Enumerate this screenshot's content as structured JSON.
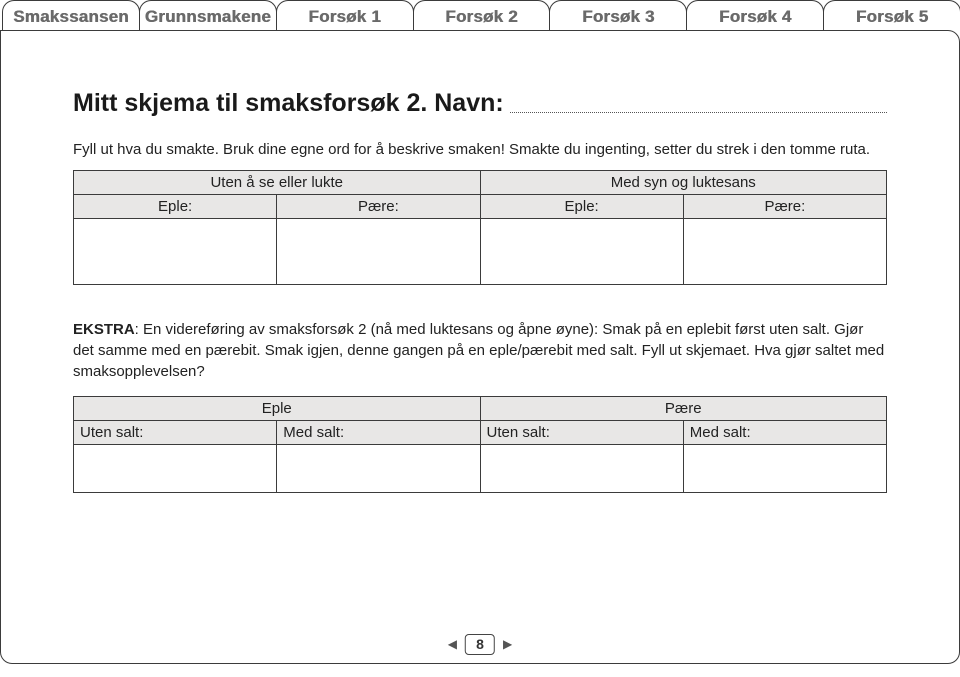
{
  "tabs": {
    "t0": "Smakssansen",
    "t1": "Grunnsmakene",
    "t2": "Forsøk 1",
    "t3": "Forsøk 2",
    "t4": "Forsøk 3",
    "t5": "Forsøk 4",
    "t6": "Forsøk 5"
  },
  "title": "Mitt skjema til smaksforsøk 2. Navn:",
  "instructions": "Fyll ut hva du smakte. Bruk dine egne ord for å beskrive smaken! Smakte du ingenting, setter du strek i den tomme ruta.",
  "table1": {
    "hdr1": "Uten å se eller lukte",
    "hdr2": "Med syn og luktesans",
    "c1": "Eple:",
    "c2": "Pære:",
    "c3": "Eple:",
    "c4": "Pære:"
  },
  "extra_bold": "EKSTRA",
  "extra_text": ": En videreføring av smaksforsøk 2 (nå med luktesans og åpne øyne): Smak på en eplebit først uten salt. Gjør det samme med en pærebit. Smak igjen, denne gangen på en eple/pærebit med salt. Fyll ut skjemaet. Hva gjør saltet med smaksopplevelsen?",
  "table2": {
    "hdr1": "Eple",
    "hdr2": "Pære",
    "c1": "Uten salt:",
    "c2": "Med salt:",
    "c3": "Uten salt:",
    "c4": "Med salt:"
  },
  "page_number": "8"
}
